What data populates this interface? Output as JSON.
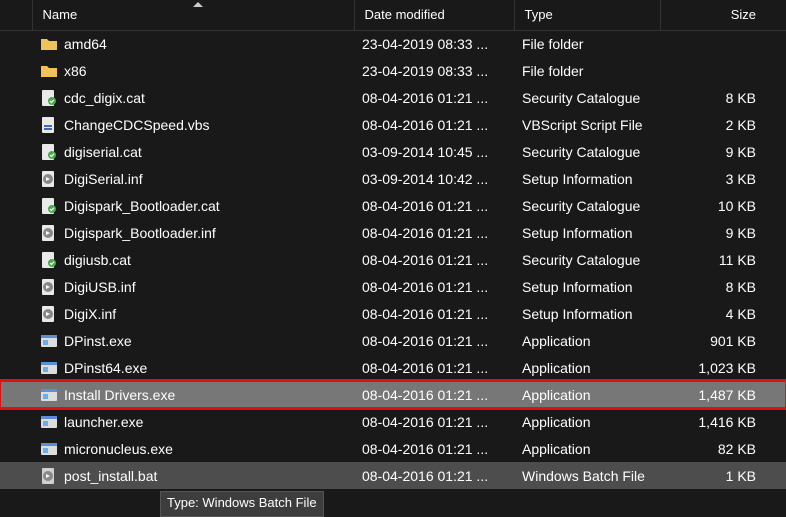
{
  "columns": {
    "name": "Name",
    "date": "Date modified",
    "type": "Type",
    "size": "Size"
  },
  "tooltip": "Type: Windows Batch File",
  "rows": [
    {
      "icon": "folder",
      "name": "amd64",
      "date": "23-04-2019 08:33 ...",
      "type": "File folder",
      "size": ""
    },
    {
      "icon": "folder",
      "name": "x86",
      "date": "23-04-2019 08:33 ...",
      "type": "File folder",
      "size": ""
    },
    {
      "icon": "cat",
      "name": "cdc_digix.cat",
      "date": "08-04-2016 01:21 ...",
      "type": "Security Catalogue",
      "size": "8 KB"
    },
    {
      "icon": "vbs",
      "name": "ChangeCDCSpeed.vbs",
      "date": "08-04-2016 01:21 ...",
      "type": "VBScript Script File",
      "size": "2 KB"
    },
    {
      "icon": "cat",
      "name": "digiserial.cat",
      "date": "03-09-2014 10:45 ...",
      "type": "Security Catalogue",
      "size": "9 KB"
    },
    {
      "icon": "inf",
      "name": "DigiSerial.inf",
      "date": "03-09-2014 10:42 ...",
      "type": "Setup Information",
      "size": "3 KB"
    },
    {
      "icon": "cat",
      "name": "Digispark_Bootloader.cat",
      "date": "08-04-2016 01:21 ...",
      "type": "Security Catalogue",
      "size": "10 KB"
    },
    {
      "icon": "inf",
      "name": "Digispark_Bootloader.inf",
      "date": "08-04-2016 01:21 ...",
      "type": "Setup Information",
      "size": "9 KB"
    },
    {
      "icon": "cat",
      "name": "digiusb.cat",
      "date": "08-04-2016 01:21 ...",
      "type": "Security Catalogue",
      "size": "11 KB"
    },
    {
      "icon": "inf",
      "name": "DigiUSB.inf",
      "date": "08-04-2016 01:21 ...",
      "type": "Setup Information",
      "size": "8 KB"
    },
    {
      "icon": "inf",
      "name": "DigiX.inf",
      "date": "08-04-2016 01:21 ...",
      "type": "Setup Information",
      "size": "4 KB"
    },
    {
      "icon": "exe",
      "name": "DPinst.exe",
      "date": "08-04-2016 01:21 ...",
      "type": "Application",
      "size": "901 KB"
    },
    {
      "icon": "exe",
      "name": "DPinst64.exe",
      "date": "08-04-2016 01:21 ...",
      "type": "Application",
      "size": "1,023 KB"
    },
    {
      "icon": "exe",
      "name": "Install Drivers.exe",
      "date": "08-04-2016 01:21 ...",
      "type": "Application",
      "size": "1,487 KB",
      "highlight": true
    },
    {
      "icon": "exe",
      "name": "launcher.exe",
      "date": "08-04-2016 01:21 ...",
      "type": "Application",
      "size": "1,416 KB"
    },
    {
      "icon": "exe",
      "name": "micronucleus.exe",
      "date": "08-04-2016 01:21 ...",
      "type": "Application",
      "size": "82 KB"
    },
    {
      "icon": "bat",
      "name": "post_install.bat",
      "date": "08-04-2016 01:21 ...",
      "type": "Windows Batch File",
      "size": "1 KB",
      "hover": true
    }
  ]
}
